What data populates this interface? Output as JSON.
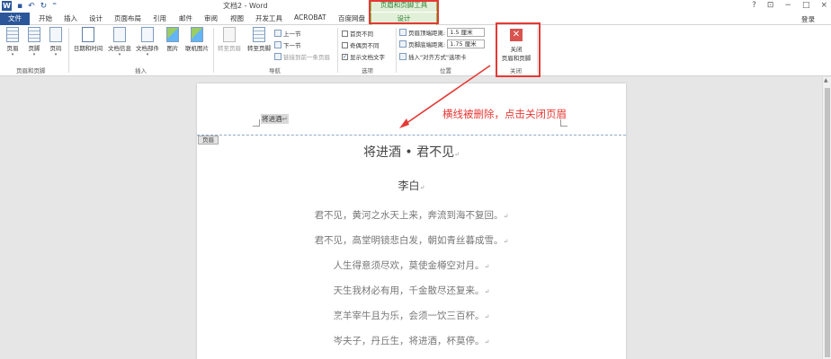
{
  "titlebar": {
    "doc_title": "文档2 - Word",
    "context_group": "页眉和页脚工具",
    "controls": [
      "?",
      "⊡",
      "−",
      "□",
      "×"
    ]
  },
  "tabs": [
    "文件",
    "开始",
    "插入",
    "设计",
    "页面布局",
    "引用",
    "邮件",
    "审阅",
    "视图",
    "开发工具",
    "ACROBAT",
    "百度网盘"
  ],
  "context_tab": "设计",
  "login": "登录",
  "ribbon": {
    "group1": {
      "buttons": [
        "页眉",
        "页脚",
        "页码"
      ],
      "label": "页眉和页脚"
    },
    "group2": {
      "buttons": [
        "日期和时间",
        "文档信息",
        "文档部件",
        "图片",
        "联机图片"
      ],
      "label": "插入"
    },
    "group3": {
      "buttons": [
        "转至页眉",
        "转至页脚"
      ],
      "small": [
        "上一节",
        "下一节",
        "链接到前一条页眉"
      ],
      "label": "导航"
    },
    "group4": {
      "options": [
        "首页不同",
        "奇偶页不同",
        "显示文档文字"
      ],
      "checked": [
        false,
        false,
        true
      ],
      "label": "选项"
    },
    "group5": {
      "header_dist_label": "页眉顶端距离:",
      "header_dist_value": "1.5 厘米",
      "footer_dist_label": "页脚底端距离:",
      "footer_dist_value": "1.75 厘米",
      "align_tab": "插入\"对齐方式\"选项卡",
      "label": "位置"
    },
    "group6": {
      "close_label": "关闭\n页眉和页脚",
      "label": "关闭"
    }
  },
  "document": {
    "header_text": "将进酒",
    "header_tag": "页眉",
    "title": "将进酒 • 君不见",
    "author": "李白",
    "lines": [
      "君不见，黄河之水天上来，奔流到海不复回。",
      "君不见，高堂明镜悲白发，朝如青丝暮成雪。",
      "人生得意须尽欢，莫使金樽空对月。",
      "天生我材必有用，千金散尽还复来。",
      "烹羊宰牛且为乐，会须一饮三百杯。",
      "岑夫子，丹丘生，将进酒，杯莫停。"
    ]
  },
  "annotation": {
    "text": "横线被删除，点击关闭页眉",
    "color": "#e53935"
  }
}
